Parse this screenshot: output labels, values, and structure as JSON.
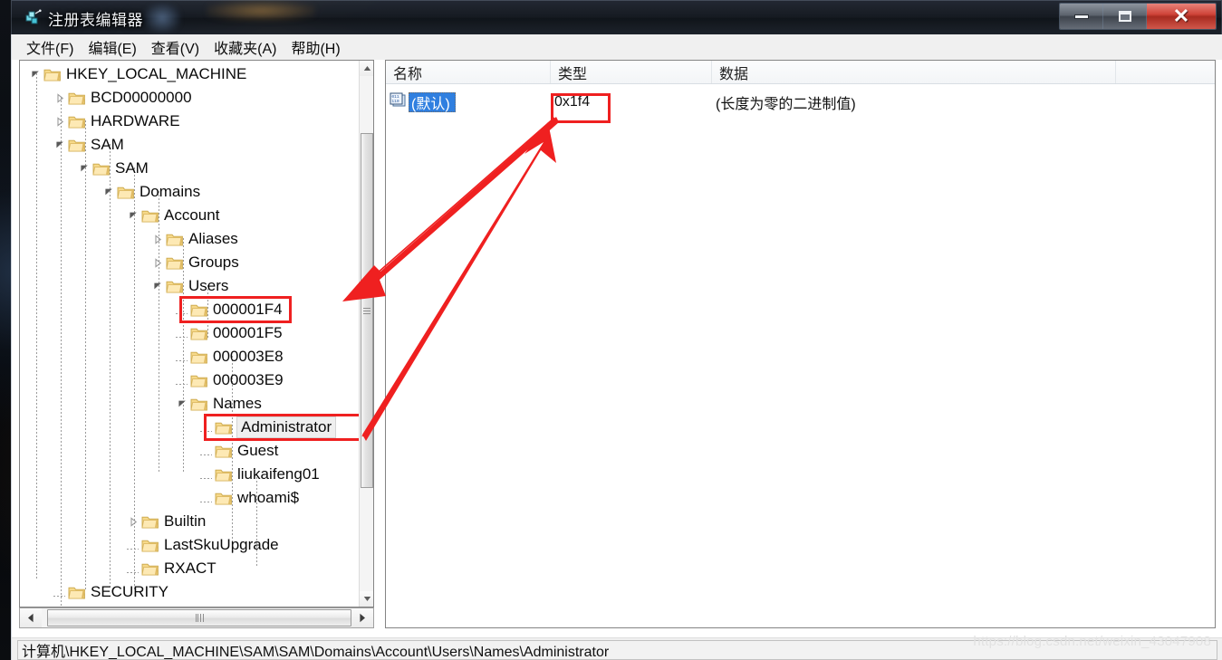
{
  "window": {
    "title": "注册表编辑器",
    "icon": "registry-editor-icon",
    "minimize_label": "—",
    "maximize_label": "□",
    "close_label": "✕"
  },
  "menubar": {
    "items": [
      {
        "label": "文件(F)"
      },
      {
        "label": "编辑(E)"
      },
      {
        "label": "查看(V)"
      },
      {
        "label": "收藏夹(A)"
      },
      {
        "label": "帮助(H)"
      }
    ]
  },
  "tree": {
    "nodes": [
      {
        "label": "HKEY_LOCAL_MACHINE",
        "depth": 0,
        "state": "expanded"
      },
      {
        "label": "BCD00000000",
        "depth": 1,
        "state": "collapsed"
      },
      {
        "label": "HARDWARE",
        "depth": 1,
        "state": "collapsed"
      },
      {
        "label": "SAM",
        "depth": 1,
        "state": "expanded"
      },
      {
        "label": "SAM",
        "depth": 2,
        "state": "expanded"
      },
      {
        "label": "Domains",
        "depth": 3,
        "state": "expanded"
      },
      {
        "label": "Account",
        "depth": 4,
        "state": "expanded"
      },
      {
        "label": "Aliases",
        "depth": 5,
        "state": "collapsed"
      },
      {
        "label": "Groups",
        "depth": 5,
        "state": "collapsed"
      },
      {
        "label": "Users",
        "depth": 5,
        "state": "expanded"
      },
      {
        "label": "000001F4",
        "depth": 6,
        "state": "leaf",
        "highlight": "red-box"
      },
      {
        "label": "000001F5",
        "depth": 6,
        "state": "leaf"
      },
      {
        "label": "000003E8",
        "depth": 6,
        "state": "leaf"
      },
      {
        "label": "000003E9",
        "depth": 6,
        "state": "leaf"
      },
      {
        "label": "Names",
        "depth": 6,
        "state": "expanded"
      },
      {
        "label": "Administrator",
        "depth": 7,
        "state": "leaf",
        "highlight": "red-box",
        "selected": true
      },
      {
        "label": "Guest",
        "depth": 7,
        "state": "leaf"
      },
      {
        "label": "liukaifeng01",
        "depth": 7,
        "state": "leaf"
      },
      {
        "label": "whoami$",
        "depth": 7,
        "state": "leaf"
      },
      {
        "label": "Builtin",
        "depth": 4,
        "state": "collapsed"
      },
      {
        "label": "LastSkuUpgrade",
        "depth": 4,
        "state": "leaf"
      },
      {
        "label": "RXACT",
        "depth": 4,
        "state": "leaf"
      },
      {
        "label": "SECURITY",
        "depth": 1,
        "state": "leaf"
      }
    ]
  },
  "list": {
    "columns": [
      {
        "key": "name",
        "label": "名称"
      },
      {
        "key": "type",
        "label": "类型"
      },
      {
        "key": "data",
        "label": "数据"
      }
    ],
    "rows": [
      {
        "name": "(默认)",
        "type": "0x1f4",
        "data": "(长度为零的二进制值)",
        "icon": "binary-value-icon",
        "selected": true,
        "type_highlight": "red-box"
      }
    ]
  },
  "statusbar": {
    "path": "计算机\\HKEY_LOCAL_MACHINE\\SAM\\SAM\\Domains\\Account\\Users\\Names\\Administrator"
  },
  "watermark": {
    "text": "https://blog.csdn.net/weixin_43047908"
  },
  "annotations": {
    "accent_color": "#ef2020",
    "arrows": [
      {
        "name": "arrow-to-000001F4",
        "from": "type-cell-0x1f4",
        "to": "tree-node-000001F4"
      },
      {
        "name": "arrow-to-administrator",
        "from": "type-cell-0x1f4",
        "to": "tree-node-administrator"
      }
    ]
  },
  "colors": {
    "selection_blue": "#2f7fe0",
    "annotation_red": "#ef2020",
    "folder_yellow": "#fdd97a",
    "window_chrome": "#f0f0f0"
  }
}
